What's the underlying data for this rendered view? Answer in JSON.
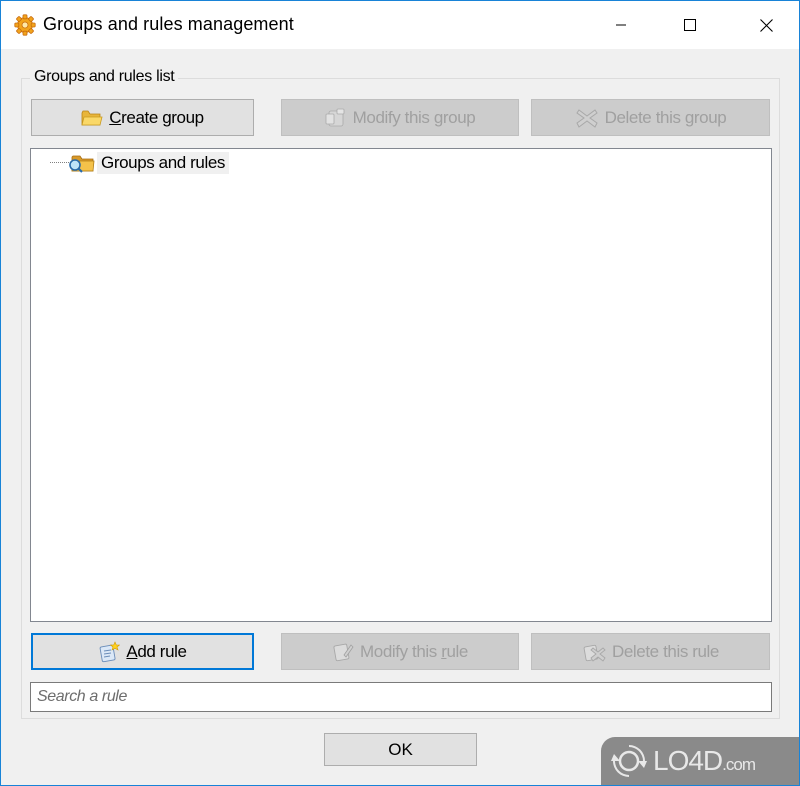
{
  "window": {
    "title": "Groups and rules management",
    "app_icon": "gear-icon",
    "controls": {
      "minimize": "minimize-icon",
      "maximize": "maximize-icon",
      "close": "close-icon"
    }
  },
  "groupbox": {
    "title": "Groups and rules list"
  },
  "group_buttons": {
    "create": {
      "label_prefix": "",
      "label_mnemonic": "C",
      "label_rest": "reate group",
      "icon": "folder-icon",
      "enabled": true
    },
    "modify": {
      "label_prefix": "Modify this ",
      "label_mnemonic": "g",
      "label_rest": "roup",
      "icon": "edit-group-icon",
      "enabled": false
    },
    "delete": {
      "label": "Delete this group",
      "icon": "delete-icon",
      "enabled": false
    }
  },
  "tree": {
    "nodes": [
      {
        "label": "Groups and rules",
        "icon": "folder-search-icon",
        "selected": true
      }
    ]
  },
  "rule_buttons": {
    "add": {
      "label_prefix": "",
      "label_mnemonic": "A",
      "label_rest": "dd rule",
      "icon": "add-rule-icon",
      "enabled": true,
      "focused": true
    },
    "modify": {
      "label_prefix": "Modify this ",
      "label_mnemonic": "r",
      "label_rest": "ule",
      "icon": "edit-rule-icon",
      "enabled": false
    },
    "delete": {
      "label": "Delete this rule",
      "icon": "delete-rule-icon",
      "enabled": false
    }
  },
  "search": {
    "placeholder": "Search a rule",
    "value": ""
  },
  "footer": {
    "ok_label": "OK"
  },
  "watermark": {
    "brand": "LO4D",
    "suffix": ".com"
  }
}
